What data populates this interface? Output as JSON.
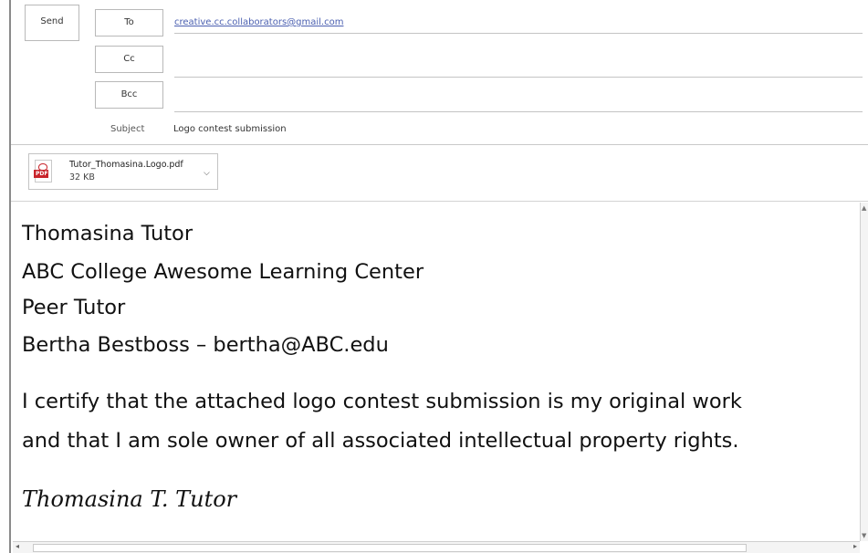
{
  "header": {
    "send_label": "Send",
    "to_label": "To",
    "to_value": "creative.cc.collaborators@gmail.com",
    "cc_label": "Cc",
    "cc_value": "",
    "bcc_label": "Bcc",
    "bcc_value": "",
    "subject_label": "Subject",
    "subject_value": "Logo contest submission"
  },
  "attachment": {
    "icon": "pdf-file-icon",
    "icon_text": "PDF",
    "name": "Tutor_Thomasina.Logo.pdf",
    "size": "32 KB",
    "menu_glyph": "⌵"
  },
  "body": {
    "lines": [
      "Thomasina Tutor",
      "ABC College Awesome Learning Center",
      "Peer Tutor",
      "Bertha Bestboss – bertha@ABC.edu"
    ],
    "certification": [
      "I certify that the attached logo contest submission is my original work",
      "and that I am sole owner of all associated intellectual property rights."
    ],
    "signature": "Thomasina T. Tutor"
  },
  "colors": {
    "link": "#4a5fb0",
    "pdf_red": "#c8242b",
    "border": "#b9b9b9"
  }
}
